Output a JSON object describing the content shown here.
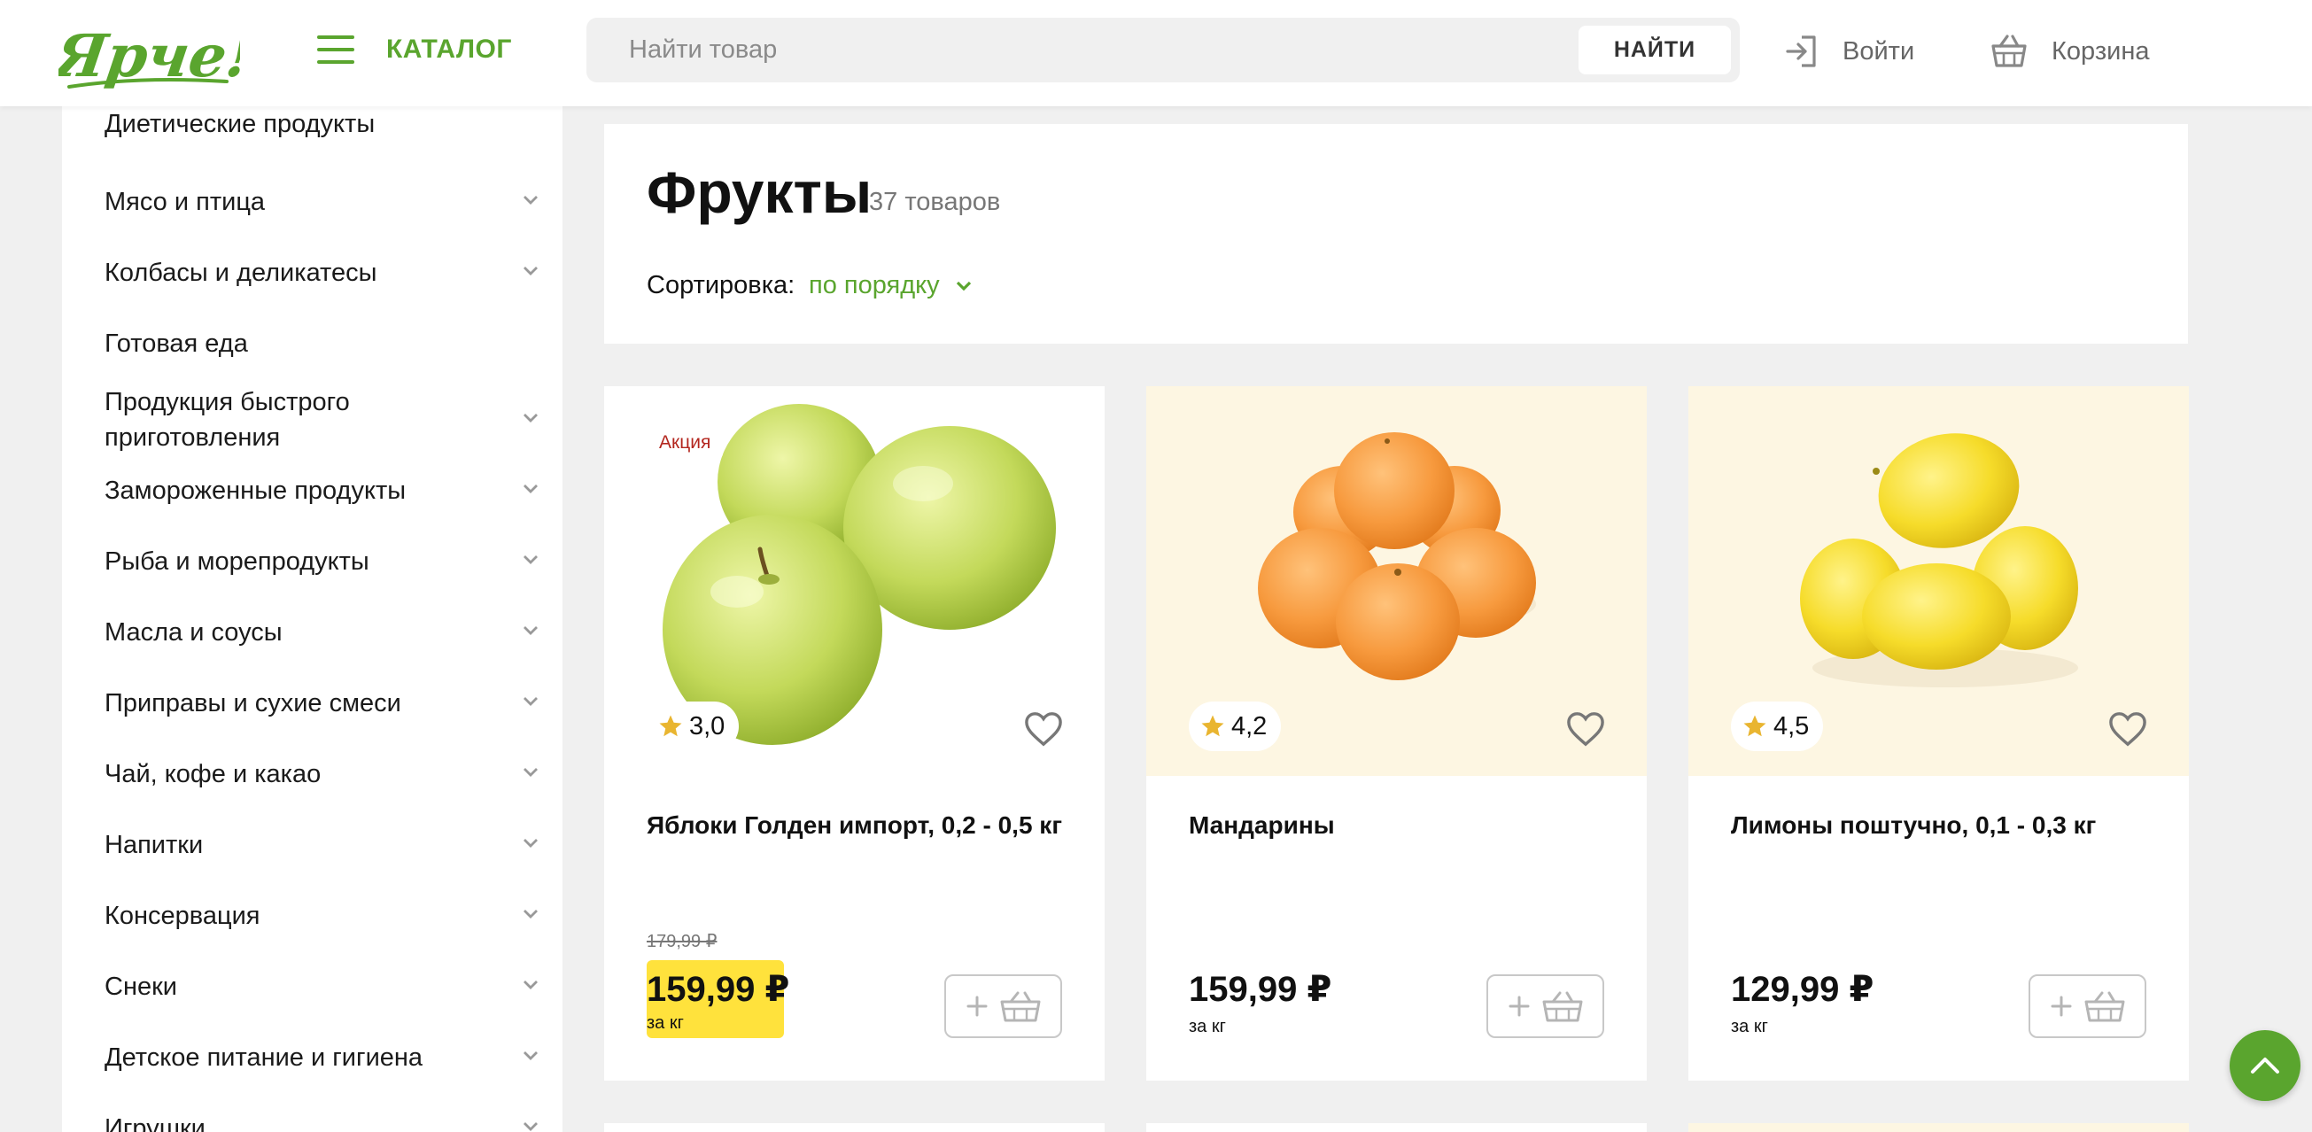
{
  "header": {
    "logo_text": "Ярче!",
    "catalog_label": "КАТАЛОГ",
    "search_placeholder": "Найти товар",
    "search_button": "НАЙТИ",
    "login_label": "Войти",
    "cart_label": "Корзина"
  },
  "sidebar": {
    "items": [
      {
        "label": "Диетические продукты",
        "has_chevron": false
      },
      {
        "label": "Мясо и птица",
        "has_chevron": true
      },
      {
        "label": "Колбасы и деликатесы",
        "has_chevron": true
      },
      {
        "label": "Готовая еда",
        "has_chevron": false
      },
      {
        "label": "Продукция быстрого приготовления",
        "has_chevron": true
      },
      {
        "label": "Замороженные продукты",
        "has_chevron": true
      },
      {
        "label": "Рыба и морепродукты",
        "has_chevron": true
      },
      {
        "label": "Масла и соусы",
        "has_chevron": true
      },
      {
        "label": "Приправы и сухие смеси",
        "has_chevron": true
      },
      {
        "label": "Чай, кофе и какао",
        "has_chevron": true
      },
      {
        "label": "Напитки",
        "has_chevron": true
      },
      {
        "label": "Консервация",
        "has_chevron": true
      },
      {
        "label": "Снеки",
        "has_chevron": true
      },
      {
        "label": "Детское питание и гигиена",
        "has_chevron": true
      },
      {
        "label": "Игрушки",
        "has_chevron": true
      }
    ]
  },
  "main": {
    "title": "Фрукты",
    "count": "37 товаров",
    "sort_label": "Сортировка:",
    "sort_value": "по порядку"
  },
  "products": [
    {
      "name": "Яблоки Голден импорт, 0,2 - 0,5 кг",
      "rating": "3,0",
      "promo": "Акция",
      "old_price": "179,99 ₽",
      "price": "159,99 ₽",
      "unit": "за кг"
    },
    {
      "name": "Мандарины",
      "rating": "4,2",
      "price": "159,99 ₽",
      "unit": "за кг"
    },
    {
      "name": "Лимоны поштучно, 0,1 - 0,3 кг",
      "rating": "4,5",
      "price": "129,99 ₽",
      "unit": "за кг"
    }
  ],
  "colors": {
    "brand_green": "#5aa52e",
    "promo_price_bg": "#ffe23c",
    "promo_badge_text": "#b3261e",
    "star": "#e9b530"
  },
  "icons": {
    "catalog": "menu-icon",
    "login": "login-icon",
    "cart": "basket-icon",
    "rating": "star-icon",
    "favorite": "heart-icon",
    "add_to_cart": "add-to-basket-icon",
    "sidebar_expand": "chevron-down-icon",
    "scroll_top": "chevron-up-icon"
  }
}
